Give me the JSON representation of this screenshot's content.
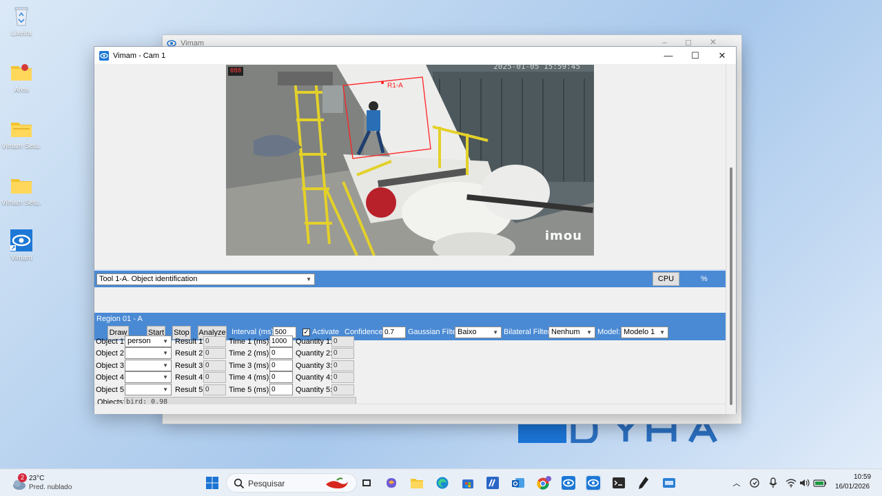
{
  "desktop": {
    "icons": [
      {
        "label": "Lixeira",
        "icon": "recycle-bin-icon"
      },
      {
        "label": "Area",
        "icon": "folder-icon"
      },
      {
        "label": "Vimam Setu...",
        "icon": "folder-icon"
      },
      {
        "label": "Vimam Setu...",
        "icon": "folder-icon"
      },
      {
        "label": "Vimam",
        "icon": "eye-app-icon"
      }
    ]
  },
  "bg_window": {
    "title": "Vimam"
  },
  "window": {
    "title": "Vimam - Cam 1",
    "camera": {
      "timestamp": "2025-01-05 15:59:45",
      "watermark": "imou",
      "counter": "088",
      "roi_label": "R1-A"
    },
    "tool_select": "Tool 1-A. Object identification",
    "cpu_button": "CPU",
    "cpu_percent": "%",
    "region": {
      "title": "Region 01 - A",
      "draw": "Draw",
      "start": "Start",
      "stop": "Stop",
      "analyze": "Analyze",
      "interval_label": "Interval (ms):",
      "interval_value": "500",
      "activate_label": "Activate",
      "activate_checked": "✓",
      "confidence_label": "Confidence:",
      "confidence_value": "0.7",
      "gaussian_label": "Gaussian Filter:",
      "gaussian_value": "Baixo",
      "bilateral_label": "Bilateral Filter:",
      "bilateral_value": "Nenhum",
      "model_label": "Model:",
      "model_value": "Modelo 1"
    },
    "rows": [
      {
        "obj_label": "Object 1:",
        "obj_value": "person",
        "res_label": "Result 1:",
        "res_value": "0",
        "time_label": "Time 1 (ms):",
        "time_value": "1000",
        "qty_label": "Quantity 1:",
        "qty_value": "0"
      },
      {
        "obj_label": "Object 2:",
        "obj_value": "",
        "res_label": "Result 2:",
        "res_value": "0",
        "time_label": "Time 2 (ms):",
        "time_value": "0",
        "qty_label": "Quantity 2:",
        "qty_value": "0"
      },
      {
        "obj_label": "Object 3:",
        "obj_value": "",
        "res_label": "Result 3:",
        "res_value": "0",
        "time_label": "Time 3 (ms):",
        "time_value": "0",
        "qty_label": "Quantity 3:",
        "qty_value": "0"
      },
      {
        "obj_label": "Object 4:",
        "obj_value": "",
        "res_label": "Result 4:",
        "res_value": "0",
        "time_label": "Time 4 (ms):",
        "time_value": "0",
        "qty_label": "Quantity 4:",
        "qty_value": "0"
      },
      {
        "obj_label": "Object 5:",
        "obj_value": "",
        "res_label": "Result 5:",
        "res_value": "0",
        "time_label": "Time 5 (ms):",
        "time_value": "0",
        "qty_label": "Quantity 5:",
        "qty_value": "0"
      }
    ],
    "objects_label": "Objects:",
    "objects_value": "bird: 0.98"
  },
  "taskbar": {
    "weather_temp": "23°C",
    "weather_desc": "Pred. nublado",
    "weather_badge": "2",
    "search_placeholder": "Pesquisar",
    "apps": [
      "start-icon",
      "search-icon",
      "chili-widget-icon",
      "task-view-icon",
      "copilot-icon",
      "file-explorer-icon",
      "edge-icon",
      "store-icon",
      "vscode-like-icon",
      "outlook-icon",
      "chrome-icon",
      "vimam-icon",
      "vimam-active-icon",
      "terminal-icon",
      "pen-icon",
      "remote-icon"
    ],
    "time": "10:59",
    "date": "16/01/2026"
  },
  "colors": {
    "accent": "#4a8ad4",
    "roi": "#ff2020"
  }
}
